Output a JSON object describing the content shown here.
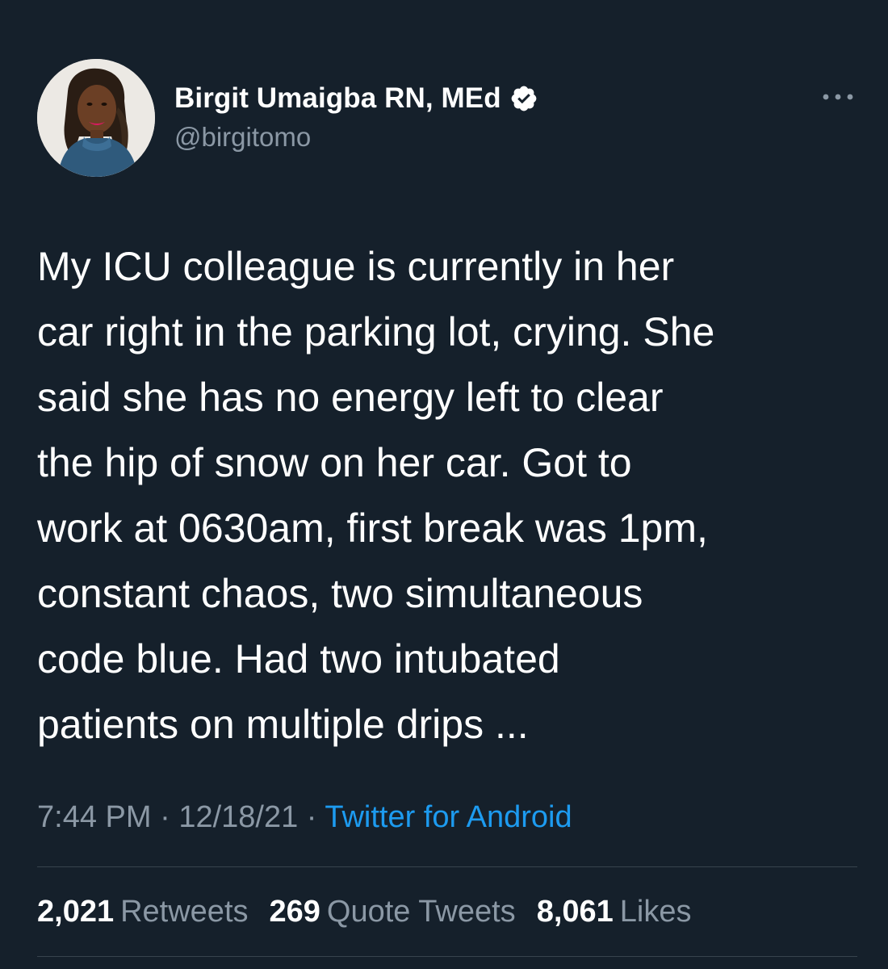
{
  "user": {
    "display_name": "Birgit Umaigba RN, MEd",
    "handle": "@birgitomo",
    "verified": true,
    "avatar_icon": "profile-photo",
    "verified_icon": "verified-badge-icon",
    "more_icon": "more-options-icon"
  },
  "tweet": {
    "lines": [
      "My ICU colleague is currently in her",
      "car right in the parking lot, crying. She",
      "said she has no energy left to clear",
      "the hip of snow on her car. Got to",
      "work at 0630am, first break was 1pm,",
      "constant chaos, two simultaneous",
      "code blue. Had two intubated",
      "patients on multiple drips ..."
    ]
  },
  "meta": {
    "time": "7:44 PM",
    "separator": " · ",
    "date": "12/18/21",
    "source": "Twitter for Android"
  },
  "stats": {
    "retweets_count": "2,021",
    "retweets_label": "Retweets",
    "quotes_count": "269",
    "quotes_label": "Quote Tweets",
    "likes_count": "8,061",
    "likes_label": "Likes"
  },
  "colors": {
    "background": "#15202b",
    "text": "#ffffff",
    "secondary_text": "#8b98a5",
    "link": "#1d9bf0",
    "divider": "#38444d"
  }
}
